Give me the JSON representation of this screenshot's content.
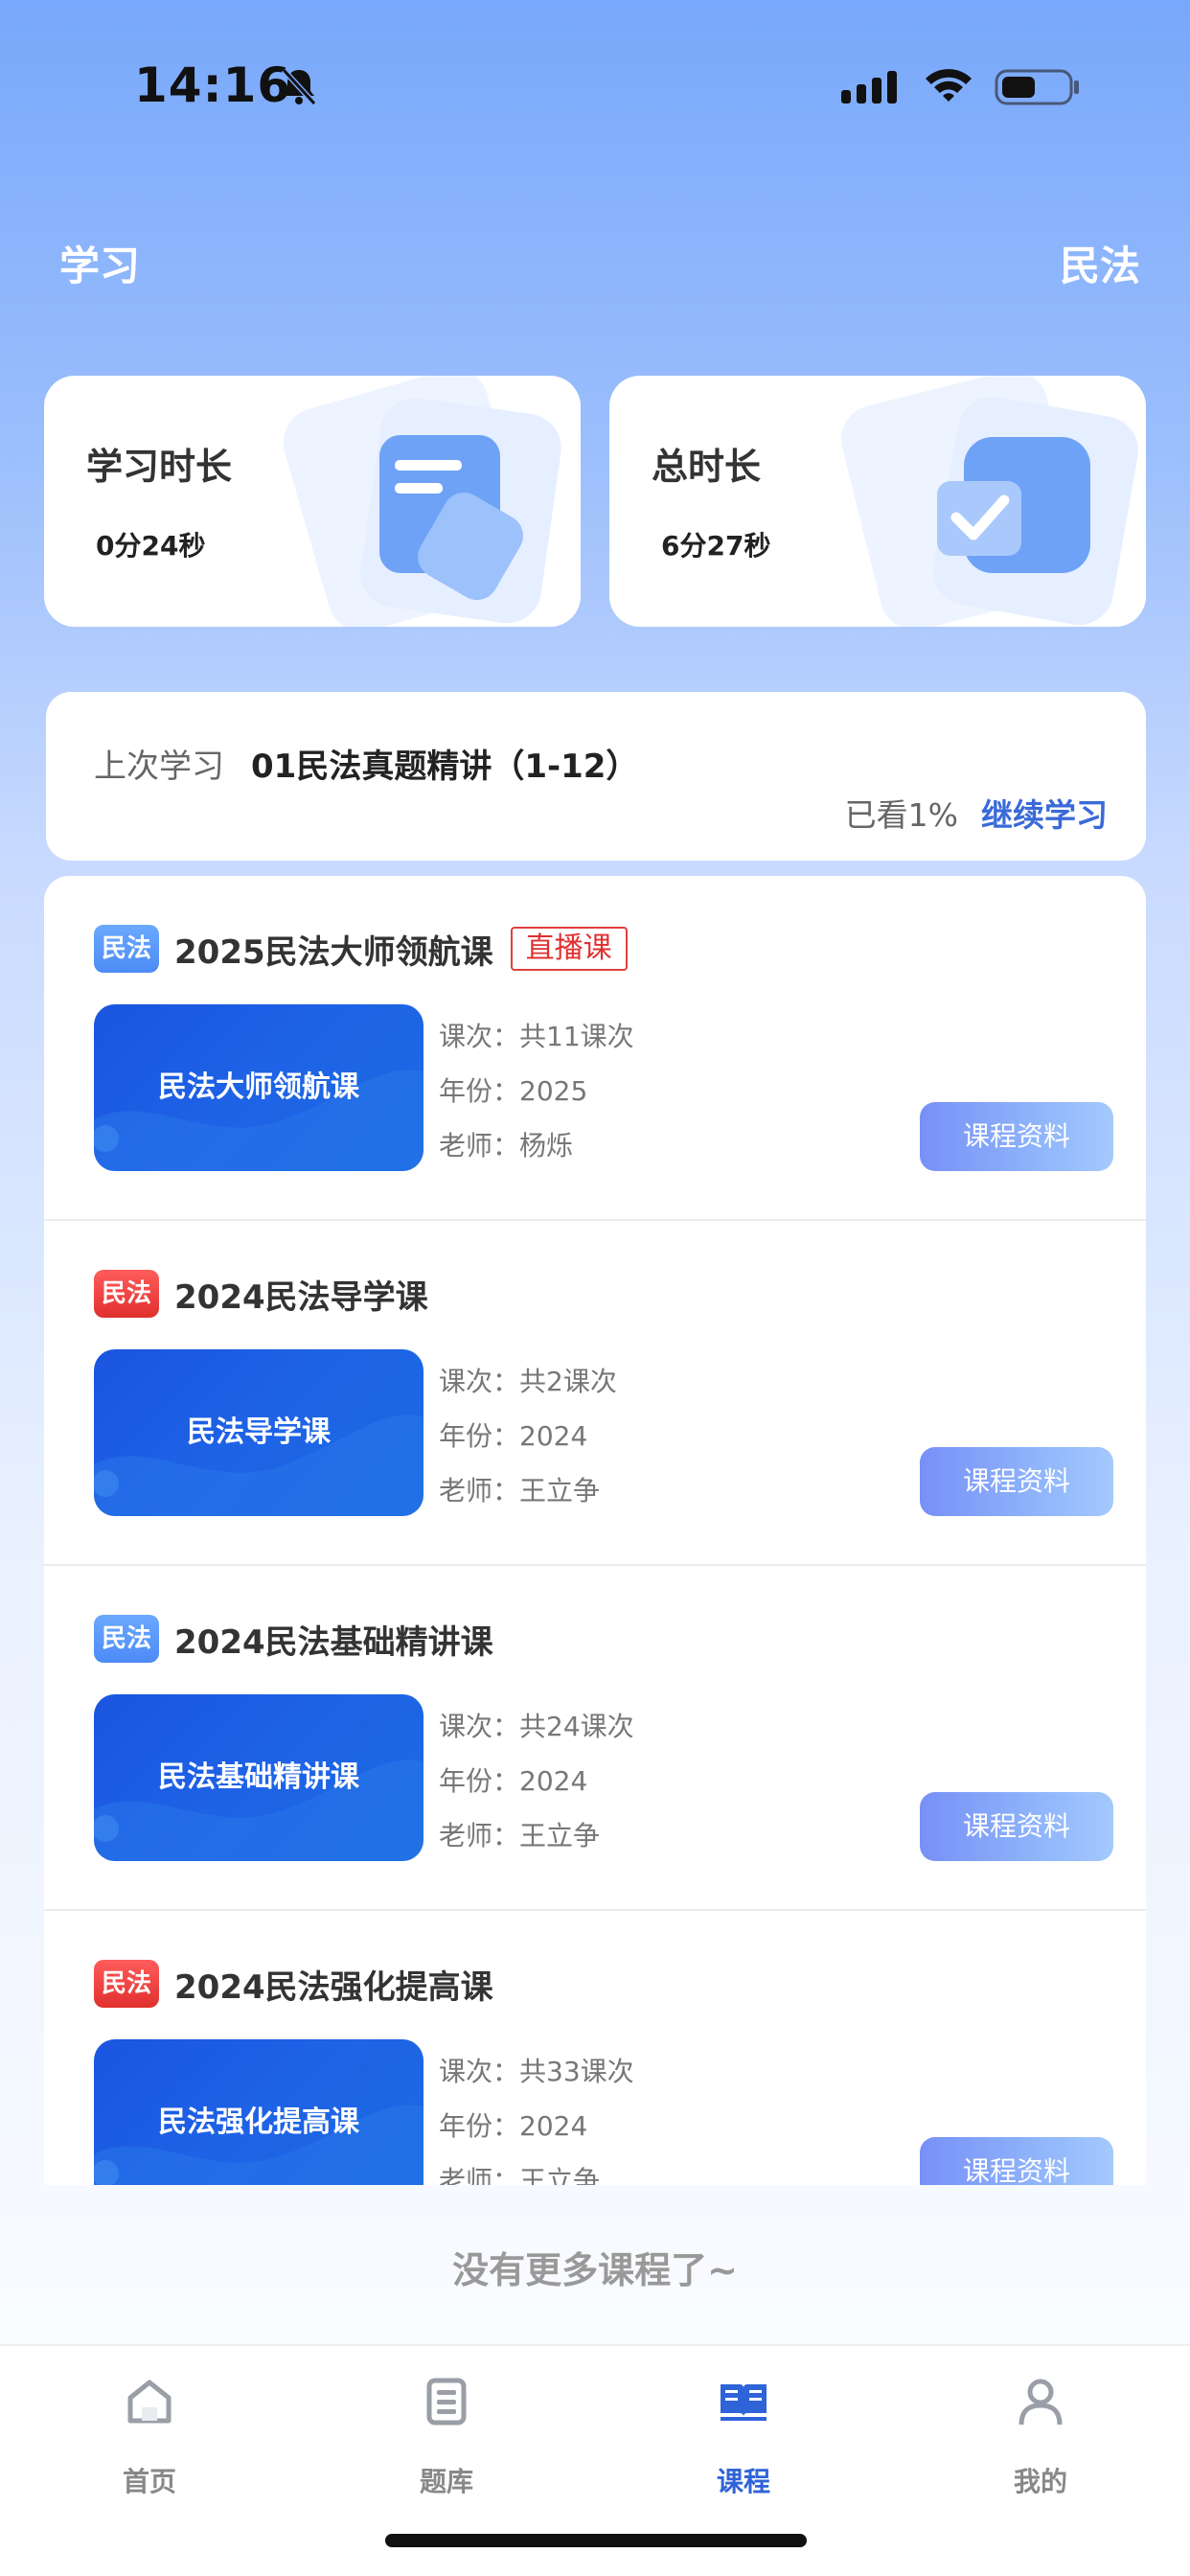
{
  "status_bar": {
    "time": "14:16"
  },
  "header": {
    "title": "学习",
    "subject": "民法"
  },
  "stats": [
    {
      "label": "学习时长",
      "value": "0分24秒"
    },
    {
      "label": "总时长",
      "value": "6分27秒"
    }
  ],
  "last_study": {
    "label": "上次学习",
    "course": "01民法真题精讲（1-12）",
    "progress": "已看1%",
    "continue_label": "继续学习"
  },
  "courses": [
    {
      "tag": "民法",
      "tag_color": "#4c8bf5",
      "title": "2025民法大师领航课",
      "live_badge": "直播课",
      "thumb_label": "民法大师领航课",
      "lessons": "课次：共11课次",
      "year": "年份：2025",
      "teacher": "老师：杨烁",
      "button": "课程资料"
    },
    {
      "tag": "民法",
      "tag_color": "#e0302e",
      "title": "2024民法导学课",
      "live_badge": "",
      "thumb_label": "民法导学课",
      "lessons": "课次：共2课次",
      "year": "年份：2024",
      "teacher": "老师：王立争",
      "button": "课程资料"
    },
    {
      "tag": "民法",
      "tag_color": "#4c8bf5",
      "title": "2024民法基础精讲课",
      "live_badge": "",
      "thumb_label": "民法基础精讲课",
      "lessons": "课次：共24课次",
      "year": "年份：2024",
      "teacher": "老师：王立争",
      "button": "课程资料"
    },
    {
      "tag": "民法",
      "tag_color": "#e0302e",
      "title": "2024民法强化提高课",
      "live_badge": "",
      "thumb_label": "民法强化提高课",
      "lessons": "课次：共33课次",
      "year": "年份：2024",
      "teacher": "老师：王立争",
      "button": "课程资料"
    }
  ],
  "footer_note": "没有更多课程了~",
  "tabs": [
    {
      "label": "首页",
      "icon": "home-icon",
      "active": false
    },
    {
      "label": "题库",
      "icon": "question-bank-icon",
      "active": false
    },
    {
      "label": "课程",
      "icon": "book-icon",
      "active": true
    },
    {
      "label": "我的",
      "icon": "profile-icon",
      "active": false
    }
  ],
  "colors": {
    "accent": "#2f63d8",
    "header_gradient_top": "#78a8fb",
    "live_red": "#e03030"
  }
}
